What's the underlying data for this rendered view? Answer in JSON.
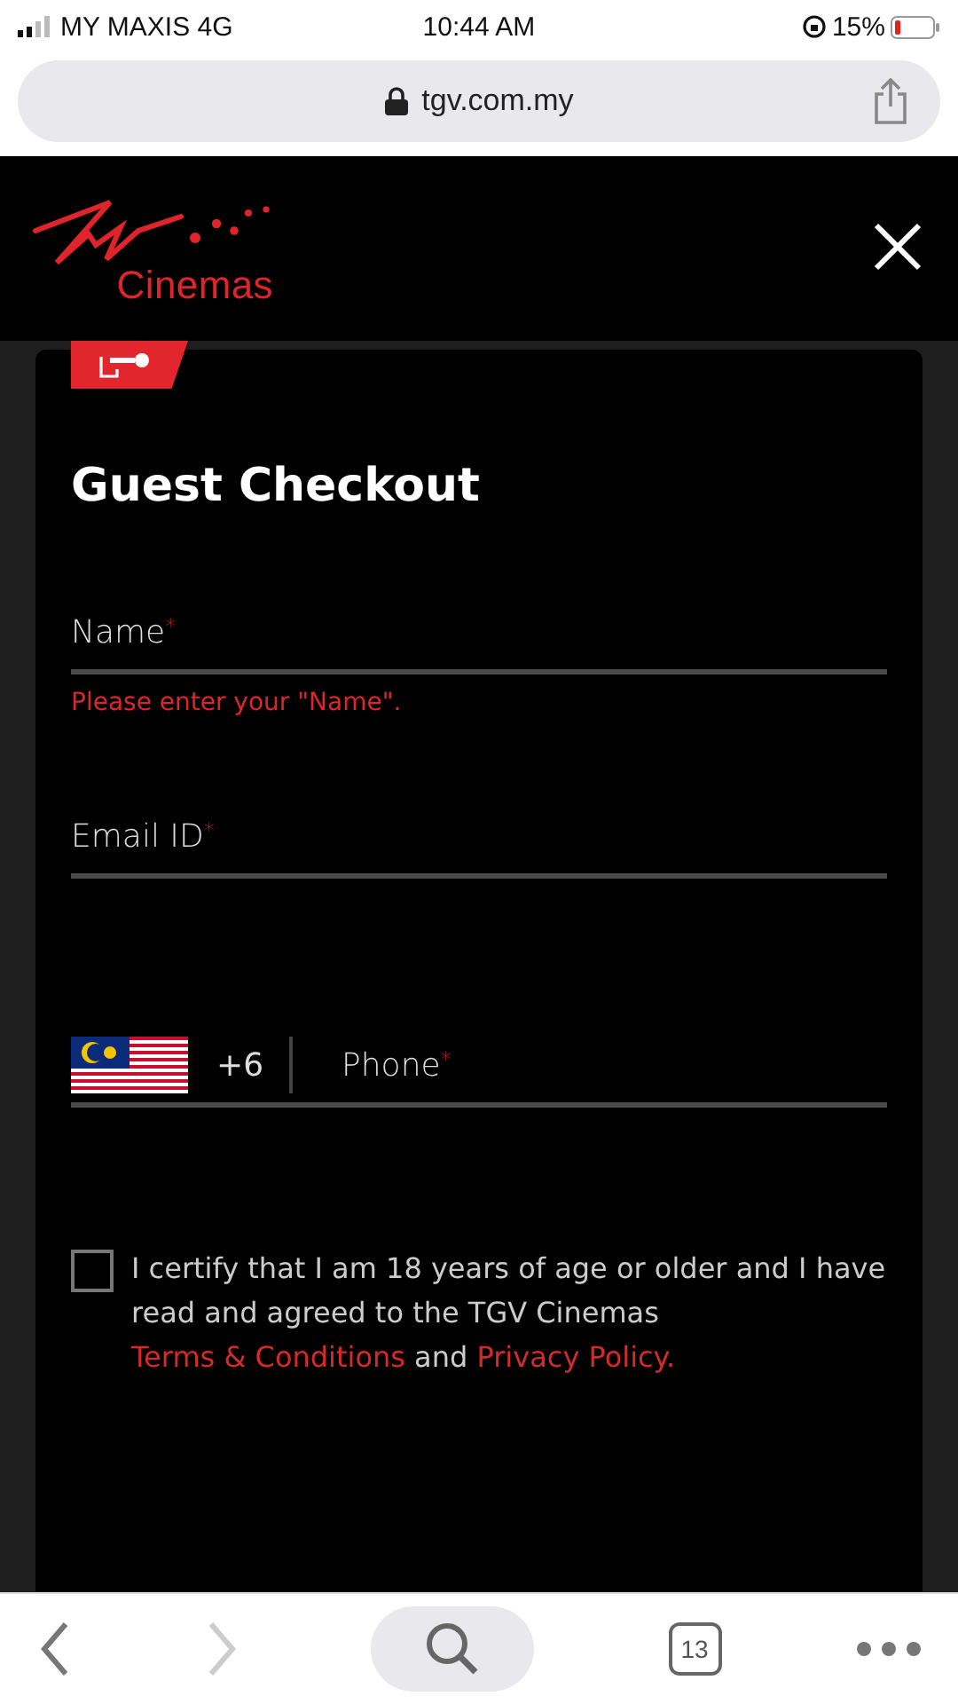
{
  "status_bar": {
    "carrier": "MY MAXIS 4G",
    "time": "10:44 AM",
    "battery": "15%"
  },
  "address_bar": {
    "url": "tgv.com.my"
  },
  "header": {
    "logo_text": "Cinemas"
  },
  "form": {
    "title": "Guest Checkout",
    "fields": [
      {
        "kind": "text",
        "label": "Name",
        "required_mark": "*",
        "error": "Please enter your \"Name\"."
      },
      {
        "kind": "text",
        "label": "Email ID",
        "required_mark": "*"
      },
      {
        "kind": "phone",
        "country_code": "+6",
        "label": "Phone",
        "required_mark": "*"
      }
    ],
    "consent": {
      "checked": false,
      "text": "I certify that I am 18 years of age or older and I have read and agreed to the TGV Cinemas ",
      "link_1": "Terms & Conditions",
      "joiner": " and ",
      "link_2": "Privacy Policy."
    }
  },
  "toolbar": {
    "back_disabled": false,
    "forward_disabled": true,
    "tab_count": "13"
  }
}
